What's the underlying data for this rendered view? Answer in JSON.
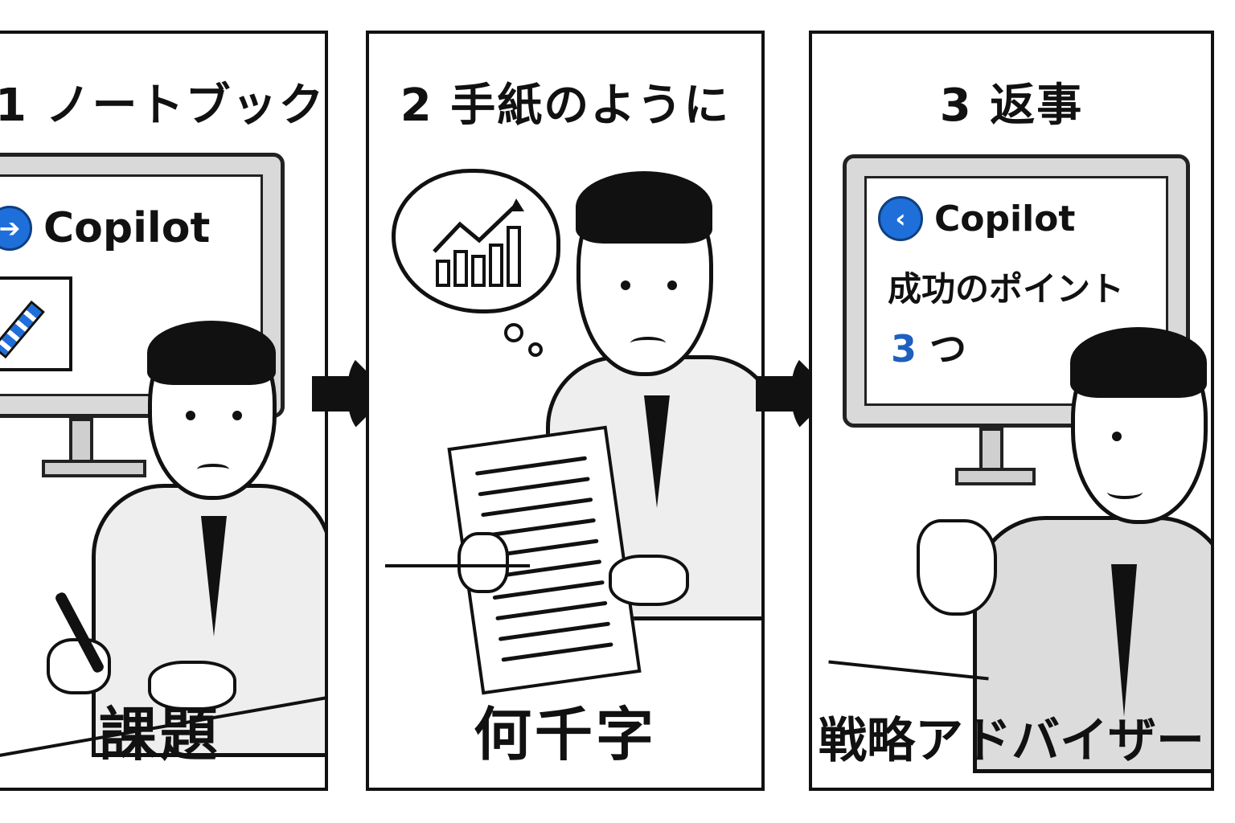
{
  "panels": [
    {
      "number": "1",
      "title": "1 ノートブック",
      "screen_brand": "Copilot",
      "caption": "課題"
    },
    {
      "number": "2",
      "title": "2 手紙のように",
      "caption": "何千字"
    },
    {
      "number": "3",
      "title": "3 返事",
      "screen_brand": "Copilot",
      "screen_line1": "成功のポイント",
      "screen_line2_number": "3",
      "screen_line2_suffix": "つ",
      "caption": "戦略アドバイザー"
    }
  ],
  "colors": {
    "copilot_blue": "#1e6fd9",
    "ink": "#111111"
  },
  "icons": {
    "arrow": "arrow-right-icon",
    "copilot": "copilot-logo-icon",
    "chart": "bar-chart-icon"
  }
}
